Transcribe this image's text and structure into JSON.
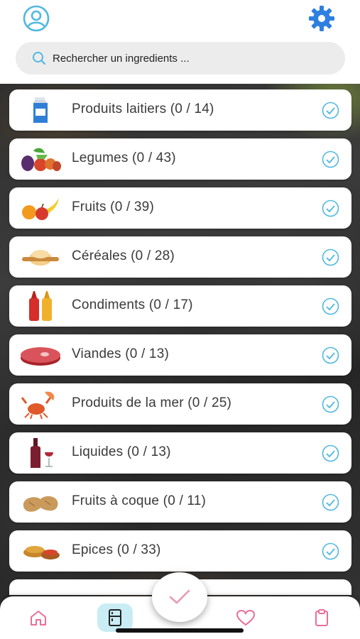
{
  "header": {
    "profile_icon": "user-circle-icon",
    "settings_icon": "gear-icon"
  },
  "search": {
    "placeholder": "Rechercher un ingredients ..."
  },
  "categories": [
    {
      "label": "Produits laitiers (0 / 14)",
      "icon": "milk-carton-icon",
      "selected": true
    },
    {
      "label": "Legumes (0 / 43)",
      "icon": "vegetables-icon",
      "selected": true
    },
    {
      "label": "Fruits (0 / 39)",
      "icon": "fruits-icon",
      "selected": true
    },
    {
      "label": "Céréales (0 / 28)",
      "icon": "dough-rolling-pin-icon",
      "selected": true
    },
    {
      "label": "Condiments (0 / 17)",
      "icon": "sauce-bottles-icon",
      "selected": true
    },
    {
      "label": "Viandes (0 / 13)",
      "icon": "steak-icon",
      "selected": true
    },
    {
      "label": "Produits de la mer (0 / 25)",
      "icon": "crab-shrimp-icon",
      "selected": true
    },
    {
      "label": "Liquides (0 / 13)",
      "icon": "wine-bottle-glass-icon",
      "selected": true
    },
    {
      "label": "Fruits à coque (0 / 11)",
      "icon": "peanut-icon",
      "selected": true
    },
    {
      "label": "Epices (0 / 33)",
      "icon": "spice-bowls-icon",
      "selected": true
    }
  ],
  "colors": {
    "accent": "#4fb8e0",
    "nav_pink": "#e86f9a",
    "active_nav_bg": "#c9ecf5",
    "fab_check": "#e89ab5"
  },
  "bottom_nav": [
    {
      "name": "home",
      "icon": "home-icon",
      "active": false
    },
    {
      "name": "fridge",
      "icon": "fridge-icon",
      "active": true
    },
    {
      "name": "favorites",
      "icon": "heart-icon",
      "active": false
    },
    {
      "name": "list",
      "icon": "clipboard-icon",
      "active": false
    }
  ],
  "fab_icon": "check-icon"
}
